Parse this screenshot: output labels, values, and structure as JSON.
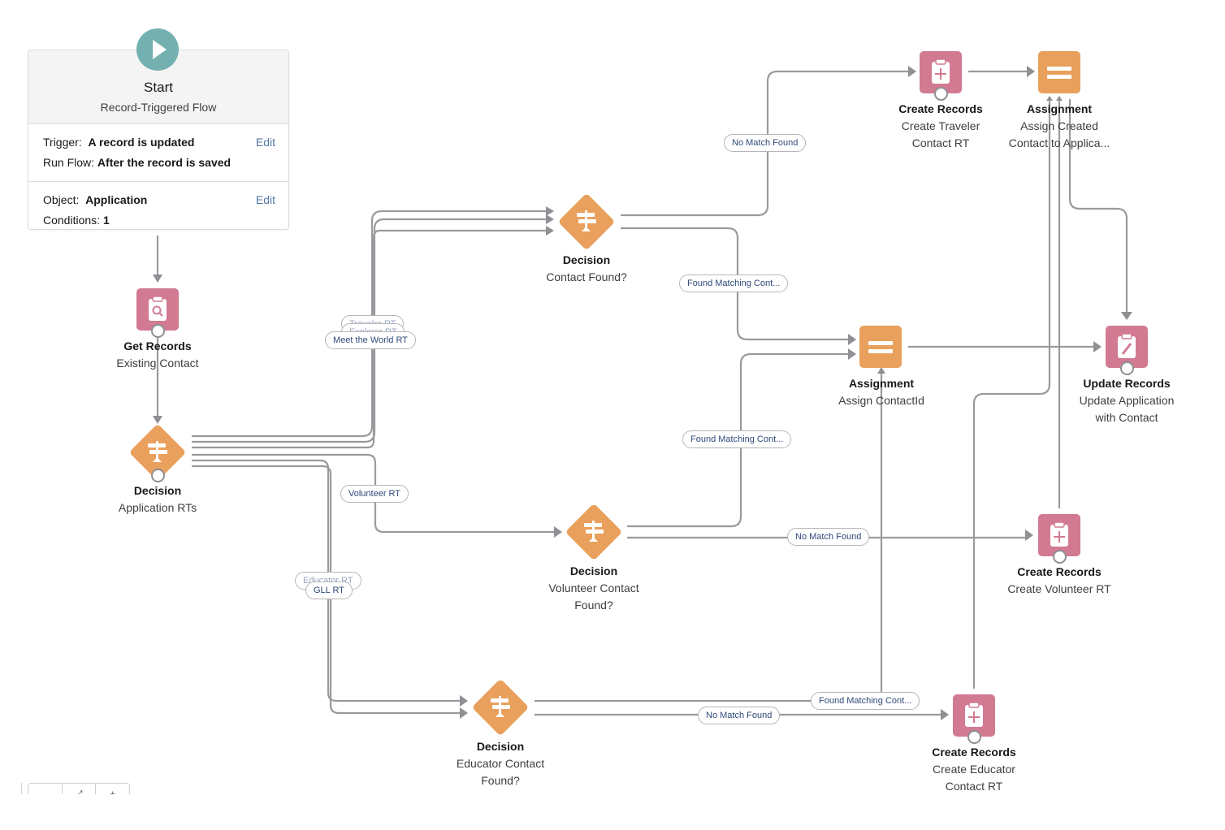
{
  "start": {
    "title": "Start",
    "subtitle": "Record-Triggered Flow",
    "trigger_label": "Trigger:",
    "trigger_value": "A record is updated",
    "run_label": "Run Flow:",
    "run_value": "After the record is saved",
    "object_label": "Object:",
    "object_value": "Application",
    "conditions_label": "Conditions:",
    "conditions_value": "1",
    "edit_label": "Edit"
  },
  "nodes": {
    "get_records": {
      "type": "Get Records",
      "name": "Existing Contact",
      "icon": "record-lookup-icon",
      "color": "#d27a92"
    },
    "decision_app": {
      "type": "Decision",
      "name": "Application RTs",
      "icon": "decision-icon",
      "color": "#e9a05c"
    },
    "decision_contact": {
      "type": "Decision",
      "name": "Contact Found?",
      "icon": "decision-icon",
      "color": "#e9a05c"
    },
    "decision_volunteer": {
      "type": "Decision",
      "name": "Volunteer Contact",
      "name2": "Found?",
      "icon": "decision-icon",
      "color": "#e9a05c"
    },
    "decision_educator": {
      "type": "Decision",
      "name": "Educator Contact",
      "name2": "Found?",
      "icon": "decision-icon",
      "color": "#e9a05c"
    },
    "create_traveler": {
      "type": "Create Records",
      "name": "Create Traveler",
      "name2": "Contact RT",
      "icon": "record-create-icon",
      "color": "#d27a92"
    },
    "assign_created": {
      "type": "Assignment",
      "name": "Assign Created",
      "name2": "Contact to Applica...",
      "icon": "assignment-icon",
      "color": "#e9a05c"
    },
    "assign_contactid": {
      "type": "Assignment",
      "name": "Assign ContactId",
      "icon": "assignment-icon",
      "color": "#e9a05c"
    },
    "update_app": {
      "type": "Update Records",
      "name": "Update Application",
      "name2": "with Contact",
      "icon": "record-update-icon",
      "color": "#d27a92"
    },
    "create_volunteer": {
      "type": "Create Records",
      "name": "Create Volunteer RT",
      "icon": "record-create-icon",
      "color": "#d27a92"
    },
    "create_educator": {
      "type": "Create Records",
      "name": "Create Educator",
      "name2": "Contact RT",
      "icon": "record-create-icon",
      "color": "#d27a92"
    }
  },
  "edge_labels": {
    "traveler_hidden_1": "Traveler RT",
    "traveler_hidden_2": "Explorer RT",
    "meet_world": "Meet the World RT",
    "volunteer": "Volunteer RT",
    "educator": "Educator RT",
    "gll": "GLL RT",
    "contact_no_match": "No Match Found",
    "contact_found": "Found Matching Cont...",
    "volunteer_found": "Found Matching Cont...",
    "volunteer_no_match": "No Match Found",
    "educator_found": "Found Matching Cont...",
    "educator_no_match": "No Match Found"
  },
  "zoom_controls": {
    "fit": "",
    "expand": "⤢",
    "zoom_in": "+"
  }
}
